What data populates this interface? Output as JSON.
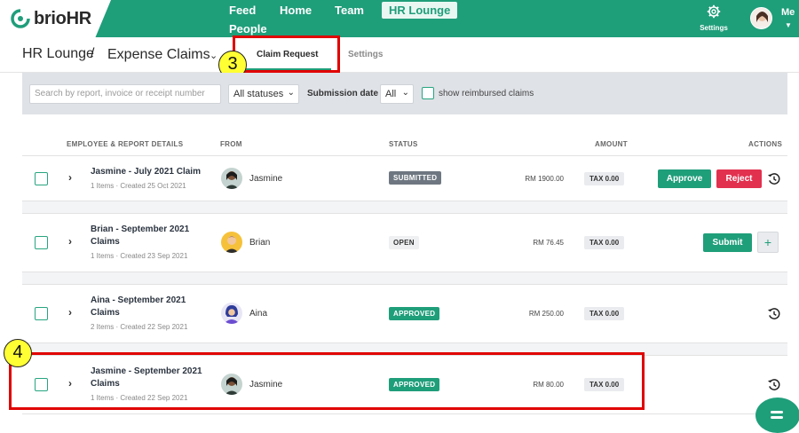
{
  "app": {
    "logo": "brioHR"
  },
  "nav": {
    "items": [
      "Feed",
      "Home",
      "Team",
      "HR Lounge",
      "People"
    ],
    "active": "HR Lounge",
    "settings_label": "Settings",
    "me_label": "Me"
  },
  "breadcrumb": {
    "section": "HR Lounge",
    "separator": "/",
    "page": "Expense Claims"
  },
  "tabs": [
    "Claim Request",
    "Settings"
  ],
  "annotations": [
    "3",
    "4"
  ],
  "filters": {
    "search_placeholder": "Search by report, invoice or receipt number",
    "status_value": "All statuses",
    "submission_date_label": "Submission date",
    "submission_date_value": "All",
    "show_reimbursed_label": "show reimbursed claims"
  },
  "table": {
    "headers": [
      "EMPLOYEE & REPORT DETAILS",
      "FROM",
      "STATUS",
      "AMOUNT",
      "ACTIONS"
    ],
    "rows": [
      {
        "title_line1": "Jasmine - July 2021 Claim",
        "title_line2": "",
        "meta": "1 Items · Created 25 Oct 2021",
        "from": "Jasmine",
        "status": "SUBMITTED",
        "amount": "RM 1900.00",
        "tax": "TAX 0.00",
        "actions": [
          "Approve",
          "Reject"
        ]
      },
      {
        "title_line1": "Brian - September 2021",
        "title_line2": "Claims",
        "meta": "1 Items · Created 23 Sep 2021",
        "from": "Brian",
        "status": "OPEN",
        "amount": "RM 76.45",
        "tax": "TAX 0.00",
        "actions": [
          "Submit",
          "+"
        ]
      },
      {
        "title_line1": "Aina - September 2021",
        "title_line2": "Claims",
        "meta": "2 Items · Created 22 Sep 2021",
        "from": "Aina",
        "status": "APPROVED",
        "amount": "RM 250.00",
        "tax": "TAX 0.00",
        "actions": []
      },
      {
        "title_line1": "Jasmine - September 2021",
        "title_line2": "Claims",
        "meta": "1 Items · Created 22 Sep 2021",
        "from": "Jasmine",
        "status": "APPROVED",
        "amount": "RM 80.00",
        "tax": "TAX 0.00",
        "actions": []
      }
    ]
  },
  "colors": {
    "brand": "#1f9e7a",
    "reject": "#e2314f",
    "annotation": "#e00000",
    "annotation_marker": "#ffff33"
  }
}
